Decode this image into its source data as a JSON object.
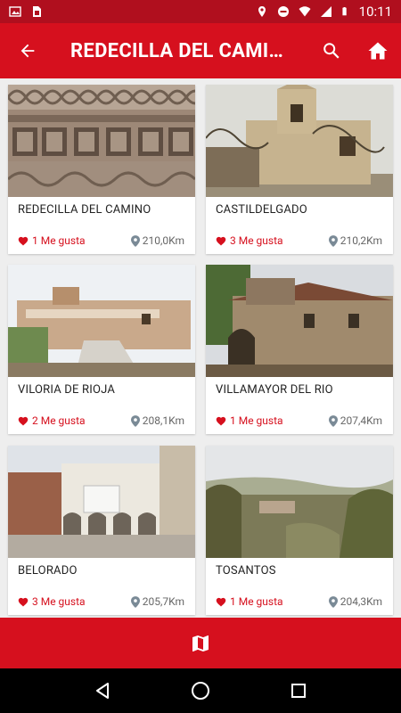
{
  "status_bar": {
    "time": "10:11",
    "icons": [
      "photo-icon",
      "sim-icon",
      "location-icon",
      "dnd-icon",
      "wifi-icon",
      "signal-icon",
      "battery-icon"
    ]
  },
  "app_bar": {
    "title": "REDECILLA DEL CAMIN…",
    "back_icon": "arrow-back-icon",
    "search_icon": "search-icon",
    "home_icon": "home-icon"
  },
  "places": [
    {
      "name": "REDECILLA DEL CAMINO",
      "likes": "1 Me gusta",
      "distance": "210,0Km"
    },
    {
      "name": "CASTILDELGADO",
      "likes": "3 Me gusta",
      "distance": "210,2Km"
    },
    {
      "name": "VILORIA DE RIOJA",
      "likes": "2 Me gusta",
      "distance": "208,1Km"
    },
    {
      "name": "VILLAMAYOR DEL RIO",
      "likes": "1 Me gusta",
      "distance": "207,4Km"
    },
    {
      "name": "BELORADO",
      "likes": "3 Me gusta",
      "distance": "205,7Km"
    },
    {
      "name": "TOSANTOS",
      "likes": "1 Me gusta",
      "distance": "204,3Km"
    }
  ],
  "bottom_action": {
    "icon": "map-icon"
  },
  "nav_bar": {
    "icons": [
      "back-triangle-icon",
      "home-circle-icon",
      "recents-square-icon"
    ]
  },
  "colors": {
    "primary": "#d6101e",
    "status": "#b00f1e",
    "like": "#d6101e"
  }
}
